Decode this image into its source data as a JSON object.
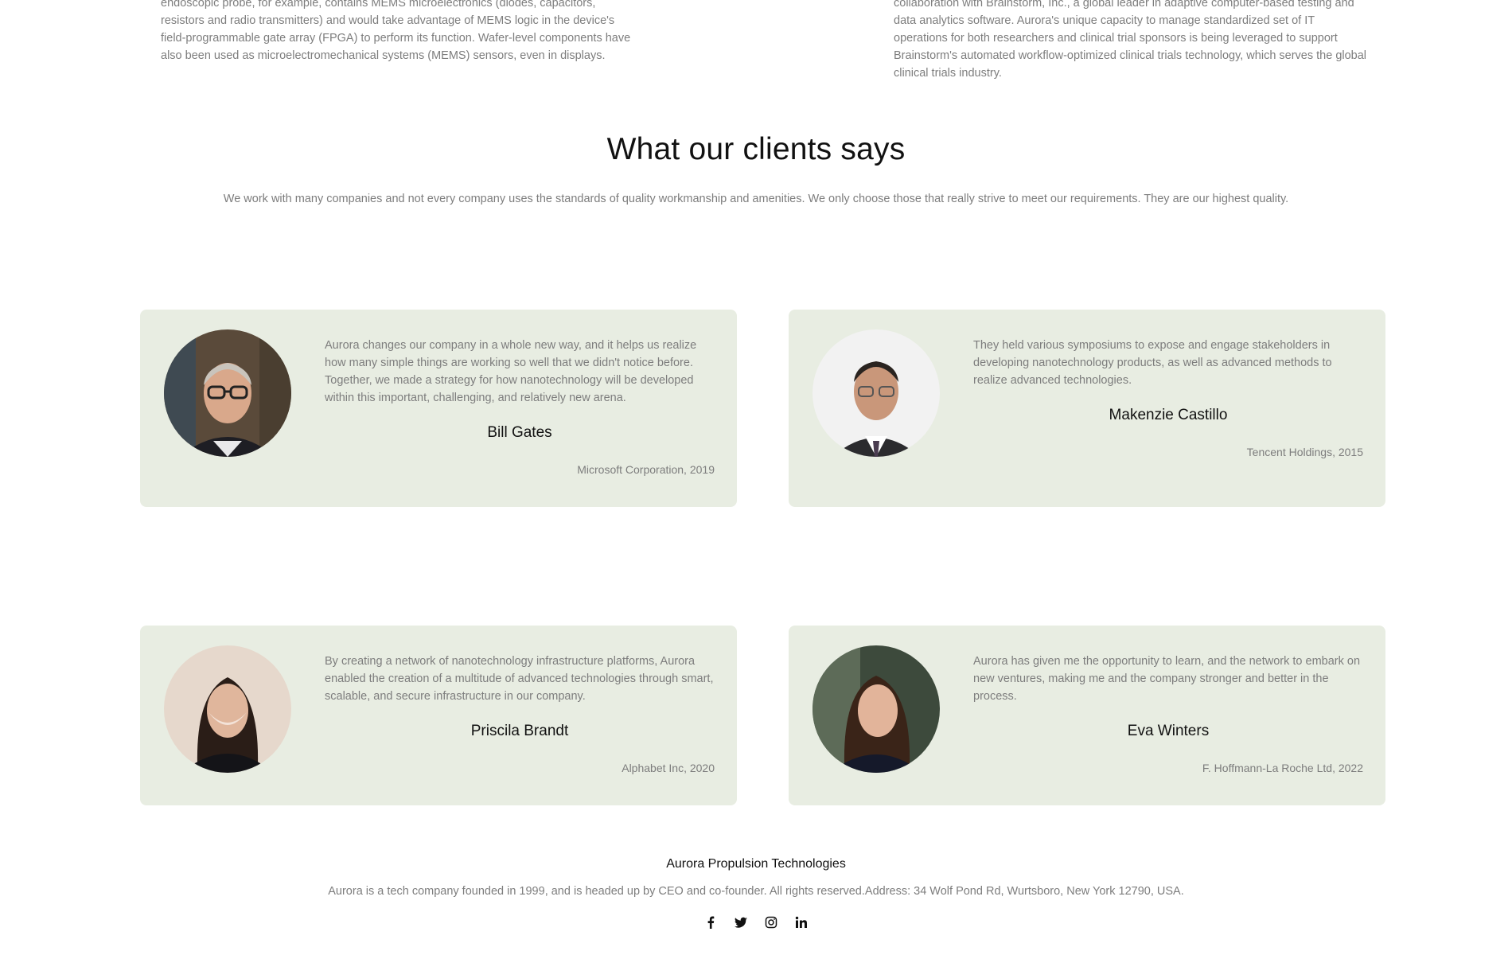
{
  "articles": {
    "left": {
      "text": "endoscopic probe, for example, contains MEMS microelectronics (diodes, capacitors, resistors and radio transmitters) and would take advantage of MEMS logic in the device's field-programmable gate array (FPGA) to perform its function. Wafer-level components have also been used as microelectromechanical systems (MEMS) sensors, even in displays."
    },
    "right": {
      "text": "collaboration with Brainstorm, Inc., a global leader in adaptive computer-based testing and data analytics software. Aurora's unique capacity to manage standardized set of IT operations for both researchers and clinical trial sponsors is being leveraged to support Brainstorm's automated workflow-optimized clinical trials technology, which serves the global clinical trials industry."
    }
  },
  "testimonials": {
    "heading": "What our clients says",
    "intro": "We work with many companies and not every company uses the standards of quality workmanship and amenities. We only choose those that really strive to meet our requirements. They are our highest quality.",
    "items": [
      {
        "quote": "Aurora changes our company in a whole new way, and it helps us realize how many simple things are working so well that we didn't notice before. Together, we made a strategy for how nanotechnology will be developed within this important, challenging, and relatively new arena.",
        "name": "Bill Gates",
        "company": "Microsoft Corporation, 2019"
      },
      {
        "quote": "They held various symposiums to expose and engage stakeholders in developing nanotechnology products, as well as advanced methods to realize advanced technologies.",
        "name": "Makenzie Castillo",
        "company": "Tencent Holdings, 2015"
      },
      {
        "quote": "By creating a network of nanotechnology infrastructure platforms, Aurora enabled the creation of a multitude of advanced technologies through smart, scalable, and secure infrastructure in our company.",
        "name": "Priscila Brandt",
        "company": "Alphabet Inc, 2020"
      },
      {
        "quote": "Aurora has given me the opportunity to learn, and the network to embark on new ventures, making me and the company stronger and better in the process.",
        "name": "Eva Winters",
        "company": "F. Hoffmann-La Roche Ltd, 2022"
      }
    ]
  },
  "footer": {
    "title": "Aurora Propulsion Technologies",
    "text": "Aurora is a tech company founded in 1999, and is headed up by CEO and co-founder. All rights reserved.Address: 34 Wolf Pond Rd, Wurtsboro, New York 12790, USA.",
    "socials": [
      "facebook-icon",
      "twitter-icon",
      "instagram-icon",
      "linkedin-icon"
    ]
  },
  "colors": {
    "card_bg": "#e8ede2",
    "heading": "#111111",
    "body_text": "#7d7d7d"
  }
}
